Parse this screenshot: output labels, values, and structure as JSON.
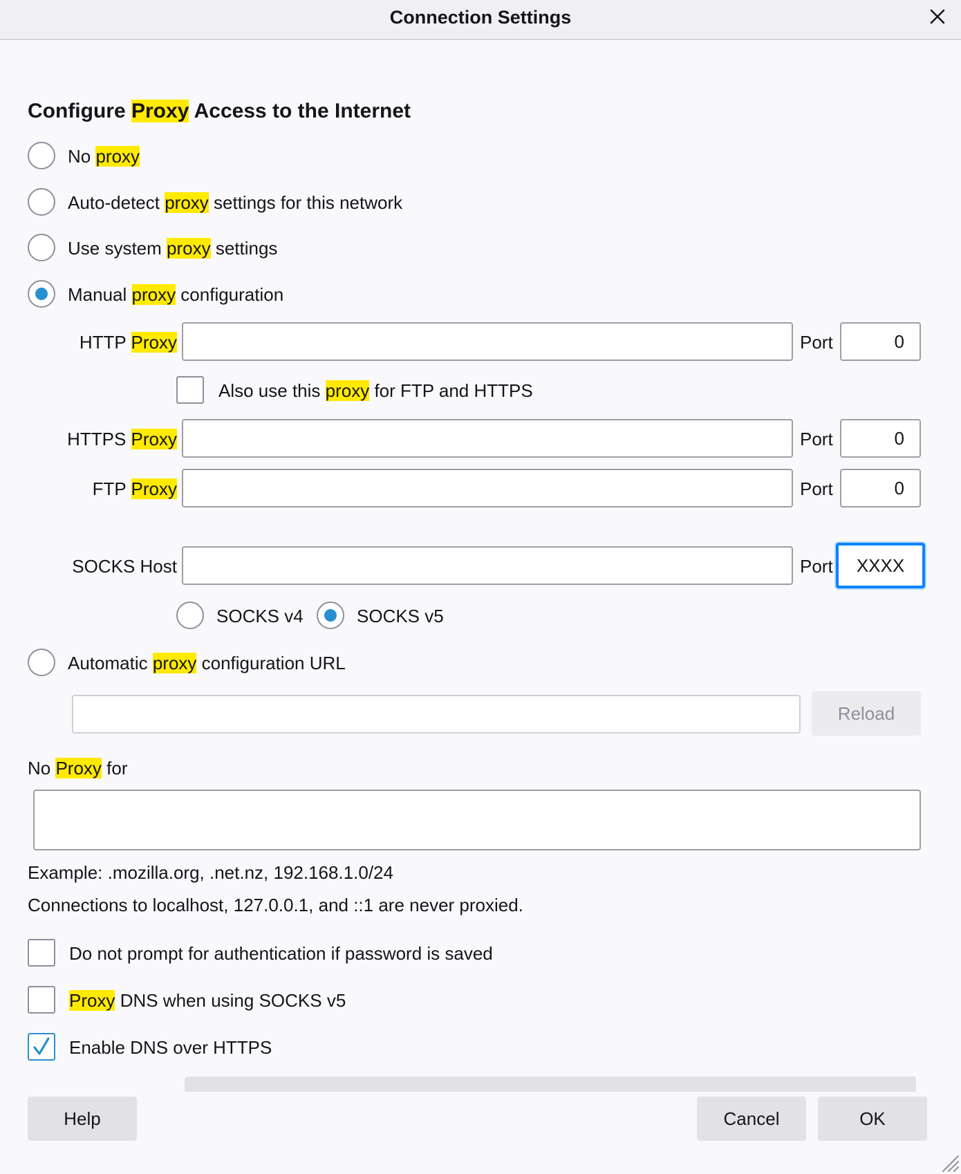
{
  "window": {
    "title": "Connection Settings"
  },
  "heading": {
    "before": "Configure ",
    "hl": "Proxy",
    "after": " Access to the Internet"
  },
  "radios": {
    "no_proxy": {
      "before": "No ",
      "hl": "proxy",
      "after": "",
      "checked": false
    },
    "auto_detect": {
      "before": "Auto-detect ",
      "hl": "proxy",
      "after": " settings for this network",
      "checked": false
    },
    "system": {
      "before": "Use system ",
      "hl": "proxy",
      "after": " settings",
      "checked": false
    },
    "manual": {
      "before": "Manual ",
      "hl": "proxy",
      "after": " configuration",
      "checked": true
    },
    "auto_url": {
      "before": "Automatic ",
      "hl": "proxy",
      "after": " configuration URL",
      "checked": false
    }
  },
  "manual": {
    "http": {
      "before": "HTTP ",
      "hl": "Proxy",
      "value": "",
      "port_label": "Port",
      "port": "0"
    },
    "also_use": {
      "before": "Also use this ",
      "hl": "proxy",
      "after": " for FTP and HTTPS",
      "checked": false
    },
    "https": {
      "before": "HTTPS ",
      "hl": "Proxy",
      "value": "",
      "port_label": "Port",
      "port": "0"
    },
    "ftp": {
      "before": "FTP ",
      "hl": "Proxy",
      "value": "",
      "port_label": "Port",
      "port": "0"
    },
    "socks": {
      "label": "SOCKS Host",
      "value": "",
      "port_label": "Port",
      "port": "XXXX"
    },
    "socks_v4": {
      "label": "SOCKS v4",
      "checked": false
    },
    "socks_v5": {
      "label": "SOCKS v5",
      "checked": true
    }
  },
  "auto_url": {
    "value": "",
    "reload_label": "Reload"
  },
  "no_proxy_for": {
    "before": "No ",
    "hl": "Proxy",
    "after": " for",
    "value": "",
    "example": "Example: .mozilla.org, .net.nz, 192.168.1.0/24",
    "note": "Connections to localhost, 127.0.0.1, and ::1 are never proxied."
  },
  "checkboxes": {
    "no_prompt": {
      "label": "Do not prompt for authentication if password is saved",
      "checked": false
    },
    "proxy_dns": {
      "hl": "Proxy",
      "after": " DNS when using SOCKS v5",
      "checked": false
    },
    "doh": {
      "label": "Enable DNS over HTTPS",
      "checked": true
    }
  },
  "buttons": {
    "help": "Help",
    "cancel": "Cancel",
    "ok": "OK"
  },
  "colors": {
    "highlight": "#ffea00",
    "accent": "#2a8fd0",
    "focus": "#0a84ff"
  },
  "icons": {
    "close": "close-icon",
    "check": "checkmark-icon",
    "resize": "resize-grip-icon"
  }
}
